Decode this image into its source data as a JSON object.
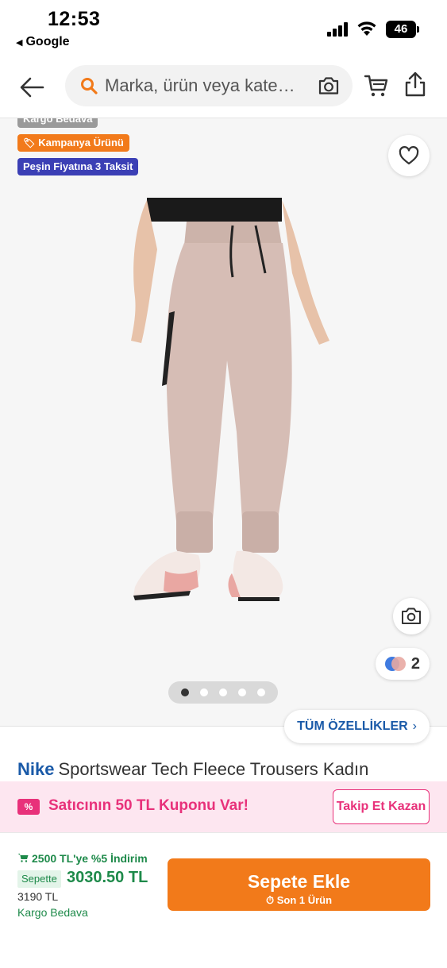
{
  "status_bar": {
    "time": "12:53",
    "back_app": "Google",
    "battery": "46"
  },
  "header": {
    "search_placeholder": "Marka, ürün veya kate…"
  },
  "badges": {
    "shipping": "Kargo Bedava",
    "campaign": "Kampanya Ürünü",
    "installment": "Peşin Fiyatına 3 Taksit"
  },
  "gallery": {
    "color_count": "2",
    "page_count": 5,
    "active_page": 1,
    "all_features": "TÜM ÖZELLİKLER"
  },
  "product": {
    "brand": "Nike",
    "name": "Sportswear Tech Fleece Trousers Kadın"
  },
  "coupon": {
    "icon_text": "%",
    "text": "Satıcının 50 TL Kuponu Var!",
    "follow_label": "Takip Et Kazan"
  },
  "purchase": {
    "discount_text": "2500 TL'ye %5 İndirim",
    "sepette_label": "Sepette",
    "price_new": "3030.50 TL",
    "price_old": "3190 TL",
    "shipping": "Kargo Bedava",
    "add_to_cart_label": "Sepete Ekle",
    "stock_note": "Son 1 Ürün"
  },
  "colors": {
    "brand_orange": "#f27a1a",
    "link_blue": "#1a5aa8",
    "coupon_pink": "#e8317a",
    "price_green": "#1e8a4a",
    "installment_blue": "#3b3fb5"
  }
}
